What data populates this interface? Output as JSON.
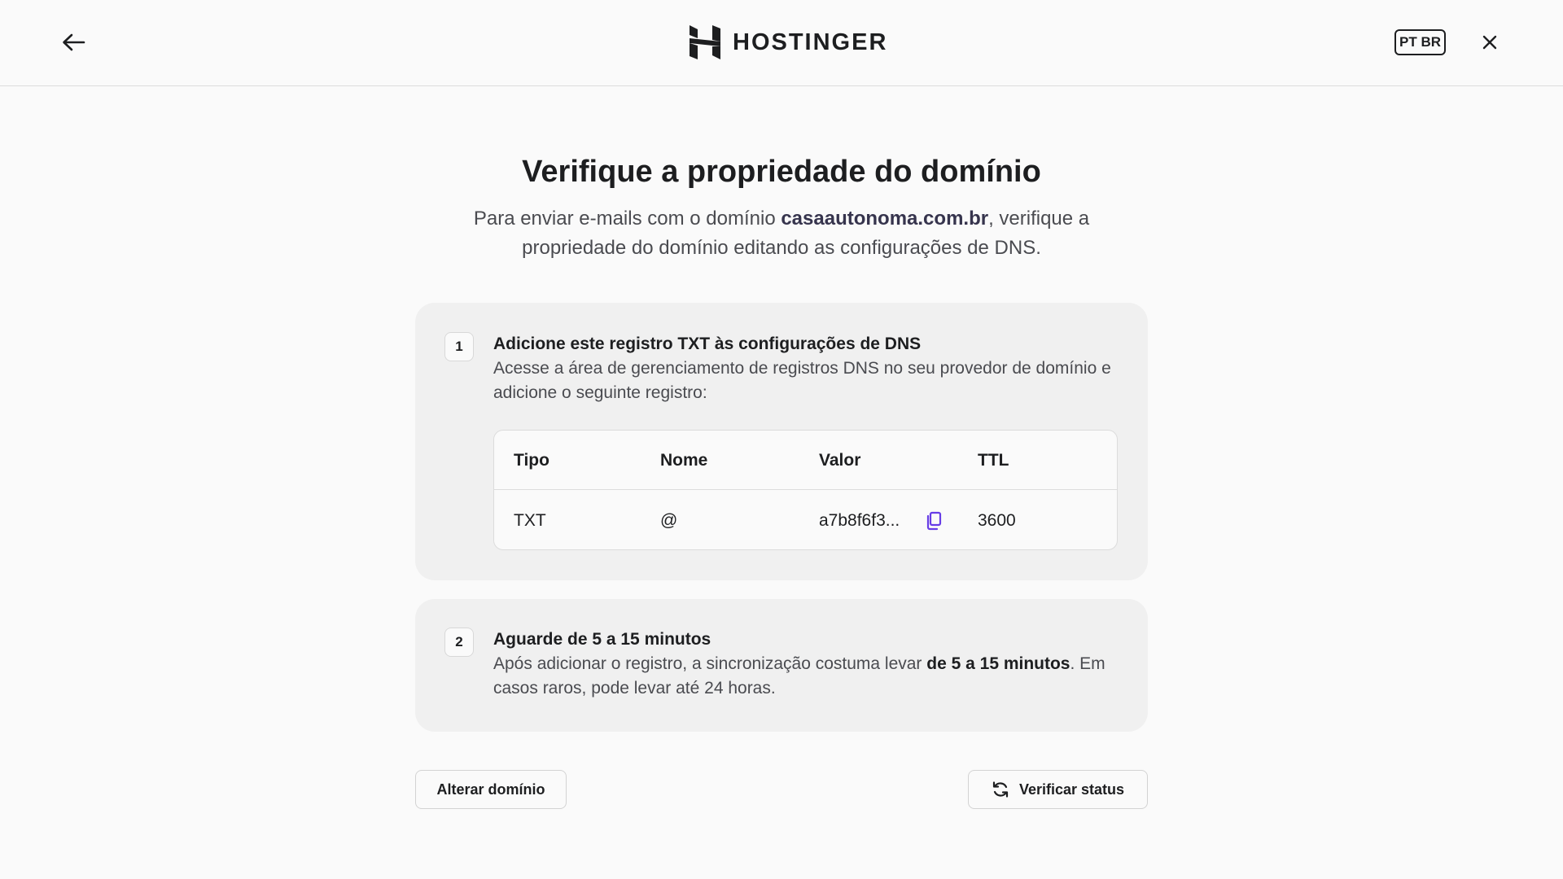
{
  "header": {
    "logo_text": "HOSTINGER",
    "language": "PT BR",
    "icons": {
      "back": "arrow-left-icon",
      "close": "close-icon",
      "logo": "hostinger-logo-icon"
    }
  },
  "page": {
    "title": "Verifique a propriedade do domínio",
    "subtitle_before": "Para enviar e-mails com o domínio ",
    "subtitle_domain": "casaautonoma.com.br",
    "subtitle_after": ", verifique a propriedade do domínio editando as configurações de DNS."
  },
  "step1": {
    "number": "1",
    "title": "Adicione este registro TXT às configurações de DNS",
    "description": "Acesse a área de gerenciamento de registros DNS no seu provedor de domínio e adicione o seguinte registro:",
    "table": {
      "headers": [
        "Tipo",
        "Nome",
        "Valor",
        "TTL"
      ],
      "row": {
        "type": "TXT",
        "name": "@",
        "value": "a7b8f6f3...",
        "ttl": "3600"
      }
    }
  },
  "step2": {
    "number": "2",
    "title": "Aguarde de 5 a 15 minutos",
    "desc_before": "Após adicionar o registro, a sincronização costuma levar ",
    "desc_bold": "de 5 a 15 minutos",
    "desc_after": ". Em casos raros, pode levar até 24 horas."
  },
  "actions": {
    "change_domain": "Alterar domínio",
    "verify_status": "Verificar status"
  },
  "colors": {
    "accent": "#673de6",
    "text": "#1d1e20",
    "muted": "#4a4b50",
    "card": "#f0f0f0",
    "background": "#fafafa"
  }
}
